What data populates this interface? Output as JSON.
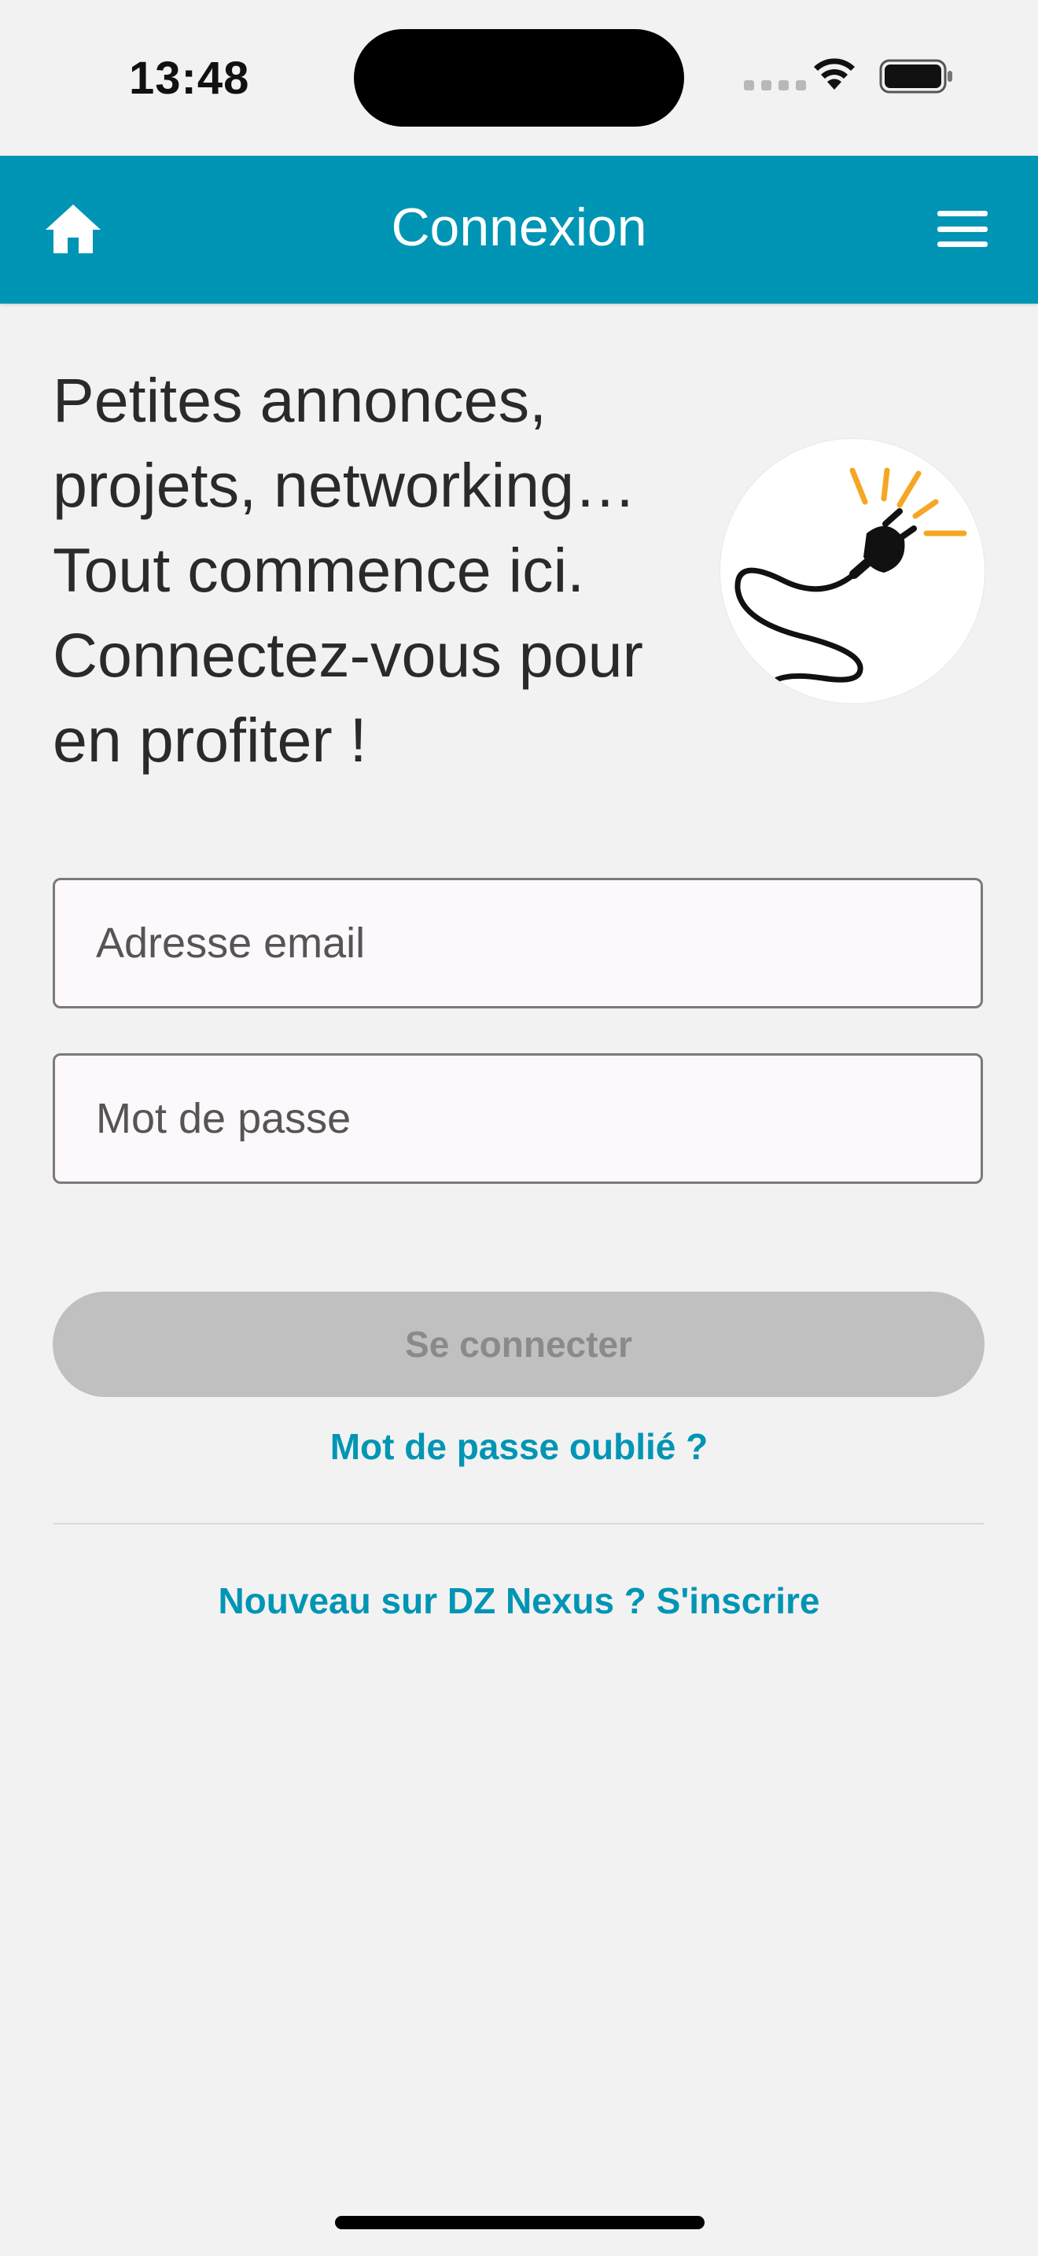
{
  "status_bar": {
    "time": "13:48",
    "wifi_icon": "wifi-icon",
    "battery_icon": "battery-full-icon"
  },
  "header": {
    "title": "Connexion",
    "home_icon": "home-icon",
    "menu_icon": "hamburger-menu-icon",
    "background_color": "#0095b4"
  },
  "intro": {
    "lines": [
      "Petites annonces,",
      "projets, networking…",
      "Tout commence ici.",
      "Connectez-vous pour",
      "en profiter !"
    ],
    "illustration": "electric-plug-icon"
  },
  "form": {
    "email_placeholder": "Adresse email",
    "email_value": "",
    "password_placeholder": "Mot de passe",
    "password_value": "",
    "login_label": "Se connecter",
    "forgot_label": "Mot de passe oublié ?",
    "signup_label": "Nouveau sur DZ Nexus ? S'inscrire"
  },
  "colors": {
    "accent": "#0095b4",
    "disabled_button": "#c0c0c0",
    "background": "#f2f2f2"
  }
}
